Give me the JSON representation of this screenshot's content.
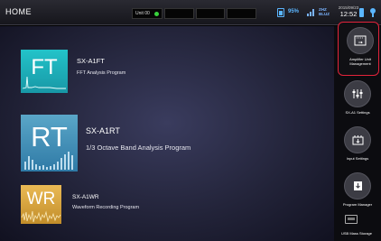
{
  "header": {
    "title": "HOME",
    "unit_label": "Unit 00",
    "battery_percent": "95%",
    "format_line1": "ZHZ",
    "format_line2": "BLUZ",
    "date": "2015/09/23",
    "time": "12:52"
  },
  "apps": [
    {
      "abbr": "FT",
      "title": "SX-A1FT",
      "subtitle": "FFT Analysis Program"
    },
    {
      "abbr": "RT",
      "title": "SX-A1RT",
      "subtitle": "1/3 Octave Band Analysis Program"
    },
    {
      "abbr": "WR",
      "title": "SX-A1WR",
      "subtitle": "Waveform Recording Program"
    }
  ],
  "sidebar": {
    "items": [
      {
        "label_line1": "Amplifier Unit",
        "label_line2": "Management",
        "icon": "amplifier-unit-icon",
        "selected": true
      },
      {
        "label_line1": "SX-A1 Settings",
        "label_line2": "",
        "icon": "sliders-icon",
        "selected": false
      },
      {
        "label_line1": "Input Settings",
        "label_line2": "",
        "icon": "input-icon",
        "selected": false
      },
      {
        "label_line1": "Program Manager",
        "label_line2": "",
        "icon": "program-manager-icon",
        "selected": false
      }
    ],
    "usb_label": "USB Mass Storage"
  },
  "colors": {
    "accent_select": "#e3233b",
    "status_blue": "#5bb6ff",
    "ft_tile": "#23c3c9",
    "rt_tile": "#4b98c0",
    "wr_tile": "#d9a840",
    "unit_ok": "#38d23c"
  }
}
